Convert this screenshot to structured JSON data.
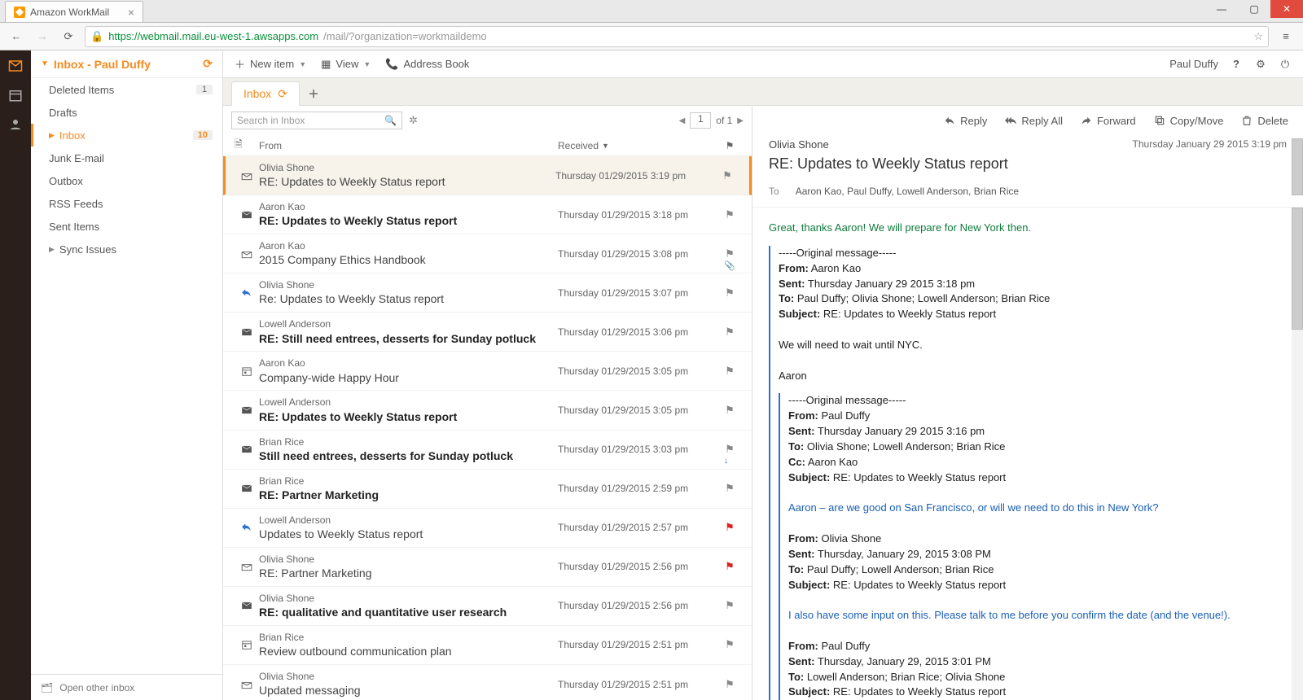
{
  "browser": {
    "tab_title": "Amazon WorkMail",
    "url_host": "https://webmail.mail.eu-west-1.awsapps.com",
    "url_path": "/mail/?organization=workmaildemo"
  },
  "user": {
    "name": "Paul Duffy"
  },
  "toolbar": {
    "new_item": "New item",
    "view": "View",
    "address_book": "Address Book"
  },
  "folders_header": "Inbox - Paul Duffy",
  "folders": [
    {
      "label": "Deleted Items",
      "count": "1",
      "sel": false,
      "tri": false
    },
    {
      "label": "Drafts",
      "count": "",
      "sel": false,
      "tri": false
    },
    {
      "label": "Inbox",
      "count": "10",
      "sel": true,
      "tri": true
    },
    {
      "label": "Junk E-mail",
      "count": "",
      "sel": false,
      "tri": false
    },
    {
      "label": "Outbox",
      "count": "",
      "sel": false,
      "tri": false
    },
    {
      "label": "RSS Feeds",
      "count": "",
      "sel": false,
      "tri": false
    },
    {
      "label": "Sent Items",
      "count": "",
      "sel": false,
      "tri": false
    },
    {
      "label": "Sync Issues",
      "count": "",
      "sel": false,
      "tri": true
    }
  ],
  "folders_footer": "Open other inbox",
  "mail_tab": "Inbox",
  "search_placeholder": "Search in Inbox",
  "pager": {
    "page": "1",
    "of": "of 1"
  },
  "list_header": {
    "from": "From",
    "received": "Received"
  },
  "messages": [
    {
      "from": "Olivia Shone",
      "subject": "RE: Updates to Weekly Status report",
      "date": "Thursday 01/29/2015 3:19 pm",
      "unread": false,
      "sel": true,
      "icon": "env-open",
      "flag": "",
      "extra": ""
    },
    {
      "from": "Aaron Kao",
      "subject": "RE: Updates to Weekly Status report",
      "date": "Thursday 01/29/2015 3:18 pm",
      "unread": true,
      "sel": false,
      "icon": "env",
      "flag": "",
      "extra": ""
    },
    {
      "from": "Aaron Kao",
      "subject": "2015 Company Ethics Handbook",
      "date": "Thursday 01/29/2015 3:08 pm",
      "unread": false,
      "sel": false,
      "icon": "env-open",
      "flag": "",
      "extra": "clip"
    },
    {
      "from": "Olivia Shone",
      "subject": "Re: Updates to Weekly Status report",
      "date": "Thursday 01/29/2015 3:07 pm",
      "unread": false,
      "sel": false,
      "icon": "reply",
      "flag": "",
      "extra": ""
    },
    {
      "from": "Lowell Anderson",
      "subject": "RE: Still need entrees, desserts for Sunday potluck",
      "date": "Thursday 01/29/2015 3:06 pm",
      "unread": true,
      "sel": false,
      "icon": "env",
      "flag": "",
      "extra": ""
    },
    {
      "from": "Aaron Kao",
      "subject": "Company-wide Happy Hour",
      "date": "Thursday 01/29/2015 3:05 pm",
      "unread": false,
      "sel": false,
      "icon": "cal",
      "flag": "",
      "extra": ""
    },
    {
      "from": "Lowell Anderson",
      "subject": "RE: Updates to Weekly Status report",
      "date": "Thursday 01/29/2015 3:05 pm",
      "unread": true,
      "sel": false,
      "icon": "env",
      "flag": "",
      "extra": ""
    },
    {
      "from": "Brian Rice",
      "subject": " Still need entrees, desserts for Sunday potluck",
      "date": "Thursday 01/29/2015 3:03 pm",
      "unread": true,
      "sel": false,
      "icon": "env",
      "flag": "",
      "extra": "down"
    },
    {
      "from": "Brian Rice",
      "subject": "RE: Partner Marketing",
      "date": "Thursday 01/29/2015 2:59 pm",
      "unread": true,
      "sel": false,
      "icon": "env",
      "flag": "",
      "extra": ""
    },
    {
      "from": "Lowell Anderson",
      "subject": "Updates to Weekly Status report",
      "date": "Thursday 01/29/2015 2:57 pm",
      "unread": false,
      "sel": false,
      "icon": "reply",
      "flag": "red",
      "extra": ""
    },
    {
      "from": "Olivia Shone",
      "subject": "RE: Partner Marketing",
      "date": "Thursday 01/29/2015 2:56 pm",
      "unread": false,
      "sel": false,
      "icon": "env-open",
      "flag": "red",
      "extra": ""
    },
    {
      "from": "Olivia Shone",
      "subject": "RE: qualitative and quantitative user research",
      "date": "Thursday 01/29/2015 2:56 pm",
      "unread": true,
      "sel": false,
      "icon": "env",
      "flag": "",
      "extra": ""
    },
    {
      "from": "Brian Rice",
      "subject": "Review outbound communication plan",
      "date": "Thursday 01/29/2015 2:51 pm",
      "unread": false,
      "sel": false,
      "icon": "cal",
      "flag": "",
      "extra": ""
    },
    {
      "from": "Olivia Shone",
      "subject": "Updated messaging",
      "date": "Thursday 01/29/2015 2:51 pm",
      "unread": false,
      "sel": false,
      "icon": "env-open",
      "flag": "",
      "extra": ""
    }
  ],
  "actions": {
    "reply": "Reply",
    "reply_all": "Reply All",
    "forward": "Forward",
    "copy_move": "Copy/Move",
    "delete": "Delete"
  },
  "preview": {
    "from": "Olivia Shone",
    "date": "Thursday January 29 2015 3:19 pm",
    "subject": "RE: Updates to Weekly Status report",
    "to_label": "To",
    "to": "Aaron Kao, Paul Duffy, Lowell Anderson, Brian Rice",
    "body_line": "Great, thanks Aaron! We will prepare for New York then.",
    "q1_orig": "-----Original message-----",
    "q1_from": "Aaron Kao",
    "q1_sent": "Thursday January 29 2015 3:18 pm",
    "q1_to": "Paul Duffy; Olivia Shone; Lowell Anderson; Brian Rice",
    "q1_subj": "RE: Updates to Weekly Status report",
    "q1_body1": "We will need to wait until NYC.",
    "q1_body2": "Aaron",
    "q2_orig": "-----Original message-----",
    "q2_from": "Paul Duffy",
    "q2_sent": "Thursday January 29 2015 3:16 pm",
    "q2_to": "Olivia Shone; Lowell Anderson; Brian Rice",
    "q2_cc": "Aaron Kao",
    "q2_subj": "RE: Updates to Weekly Status report",
    "q2_body": "Aaron – are we good on San Francisco, or will we need to do this in New York?",
    "q3_from": "Olivia Shone",
    "q3_sent": "Thursday, January 29, 2015 3:08 PM",
    "q3_to": "Paul Duffy; Lowell Anderson; Brian Rice",
    "q3_subj": "RE: Updates to Weekly Status report",
    "q3_body": "I also have some input on this.  Please talk to me before you confirm the date (and the venue!).",
    "q4_from": "Paul Duffy",
    "q4_sent": "Thursday, January 29, 2015 3:01 PM",
    "q4_to": "Lowell Anderson; Brian Rice; Olivia Shone",
    "q4_subj": "RE: Updates to Weekly Status report",
    "lbl_from": "From:",
    "lbl_sent": "Sent:",
    "lbl_to": "To:",
    "lbl_cc": "Cc:",
    "lbl_subject": "Subject:"
  }
}
